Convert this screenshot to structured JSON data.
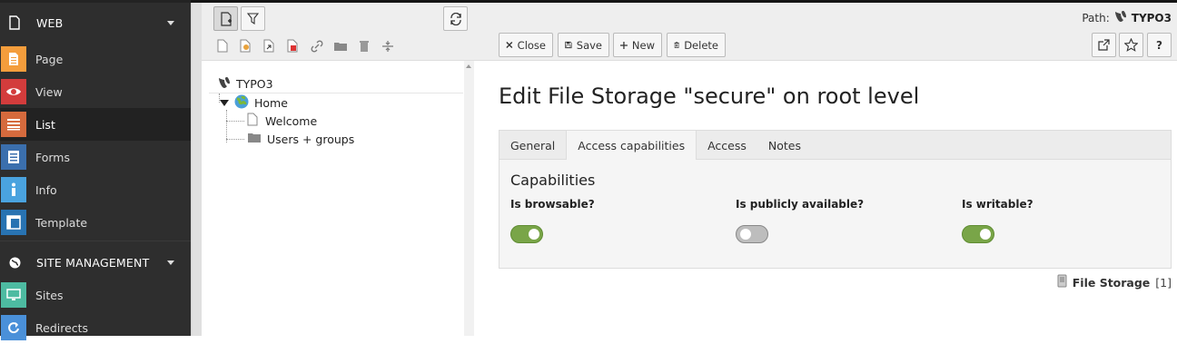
{
  "colors": {
    "accent_page": "#f49d3c",
    "accent_view": "#d33c3c",
    "accent_list": "#d56a3d",
    "accent_forms": "#3b6fad",
    "accent_info": "#4aa3df",
    "accent_template": "#2873b2",
    "accent_sites": "#4dbba1",
    "accent_redirects": "#4a90d9",
    "toggle_on": "#79a548"
  },
  "menu": {
    "group_web": {
      "label": "WEB",
      "icon": "file-icon"
    },
    "web_items": [
      {
        "label": "Page",
        "icon": "page-icon"
      },
      {
        "label": "View",
        "icon": "eye-icon"
      },
      {
        "label": "List",
        "icon": "list-icon"
      },
      {
        "label": "Forms",
        "icon": "forms-icon"
      },
      {
        "label": "Info",
        "icon": "info-icon"
      },
      {
        "label": "Template",
        "icon": "template-icon"
      }
    ],
    "group_site": {
      "label": "SITE MANAGEMENT",
      "icon": "globe-icon"
    },
    "site_items": [
      {
        "label": "Sites",
        "icon": "sites-icon"
      },
      {
        "label": "Redirects",
        "icon": "redirect-icon"
      }
    ]
  },
  "tree": {
    "root": "TYPO3",
    "home": "Home",
    "children": [
      "Welcome",
      "Users + groups"
    ]
  },
  "docheader": {
    "path_label": "Path:",
    "path_value": "TYPO3",
    "buttons": {
      "close": "Close",
      "save": "Save",
      "new": "New",
      "delete": "Delete"
    }
  },
  "content": {
    "title": "Edit File Storage \"secure\" on root level",
    "tabs": [
      "General",
      "Access capabilities",
      "Access",
      "Notes"
    ],
    "section": "Capabilities",
    "fields": [
      {
        "label": "Is browsable?",
        "on": true
      },
      {
        "label": "Is publicly available?",
        "on": false
      },
      {
        "label": "Is writable?",
        "on": true
      }
    ],
    "record_type": "File Storage",
    "record_uid": "[1]"
  }
}
